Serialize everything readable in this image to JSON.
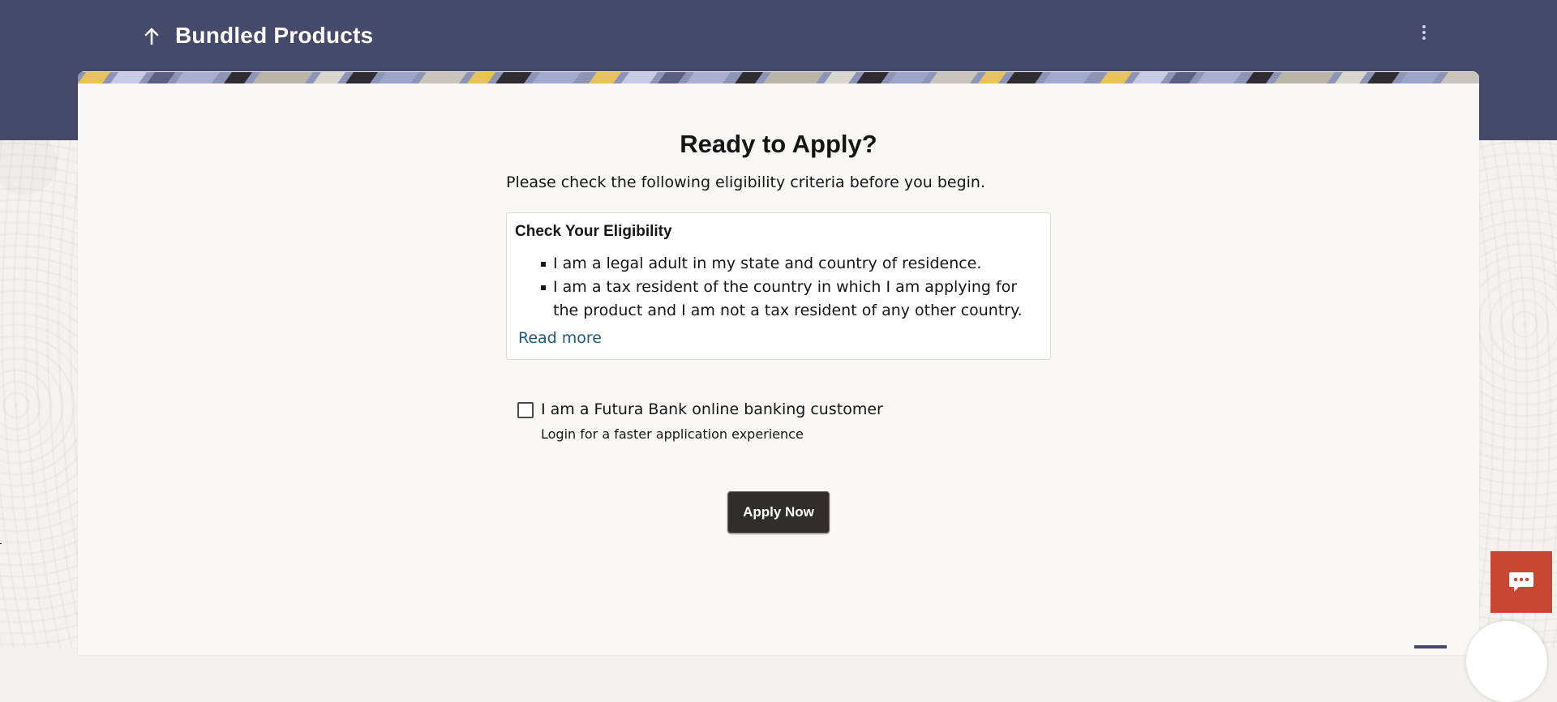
{
  "header": {
    "title": "Bundled Products",
    "back_icon": "arrow-up-icon",
    "menu_icon": "kebab-menu-icon"
  },
  "main": {
    "heading": "Ready to Apply?",
    "subtitle": "Please check the following eligibility criteria before you begin.",
    "eligibility": {
      "title": "Check Your Eligibility",
      "items": [
        "I am a legal adult in my state and country of residence.",
        "I am a tax resident of the country in which I am applying for the product and I am not a tax resident of any other country."
      ],
      "read_more": "Read more"
    },
    "customer_checkbox": {
      "label": "I am a Futura Bank online banking customer",
      "checked": false,
      "helper": "Login for a faster application experience"
    },
    "apply_button": "Apply Now"
  },
  "chat": {
    "icon": "chat-bubble-icon"
  },
  "colors": {
    "header_bg": "#464a6a",
    "card_bg": "#f9f8f6",
    "button_bg": "#312d2a",
    "link": "#1b5b80",
    "chat_bg": "#c74634"
  }
}
